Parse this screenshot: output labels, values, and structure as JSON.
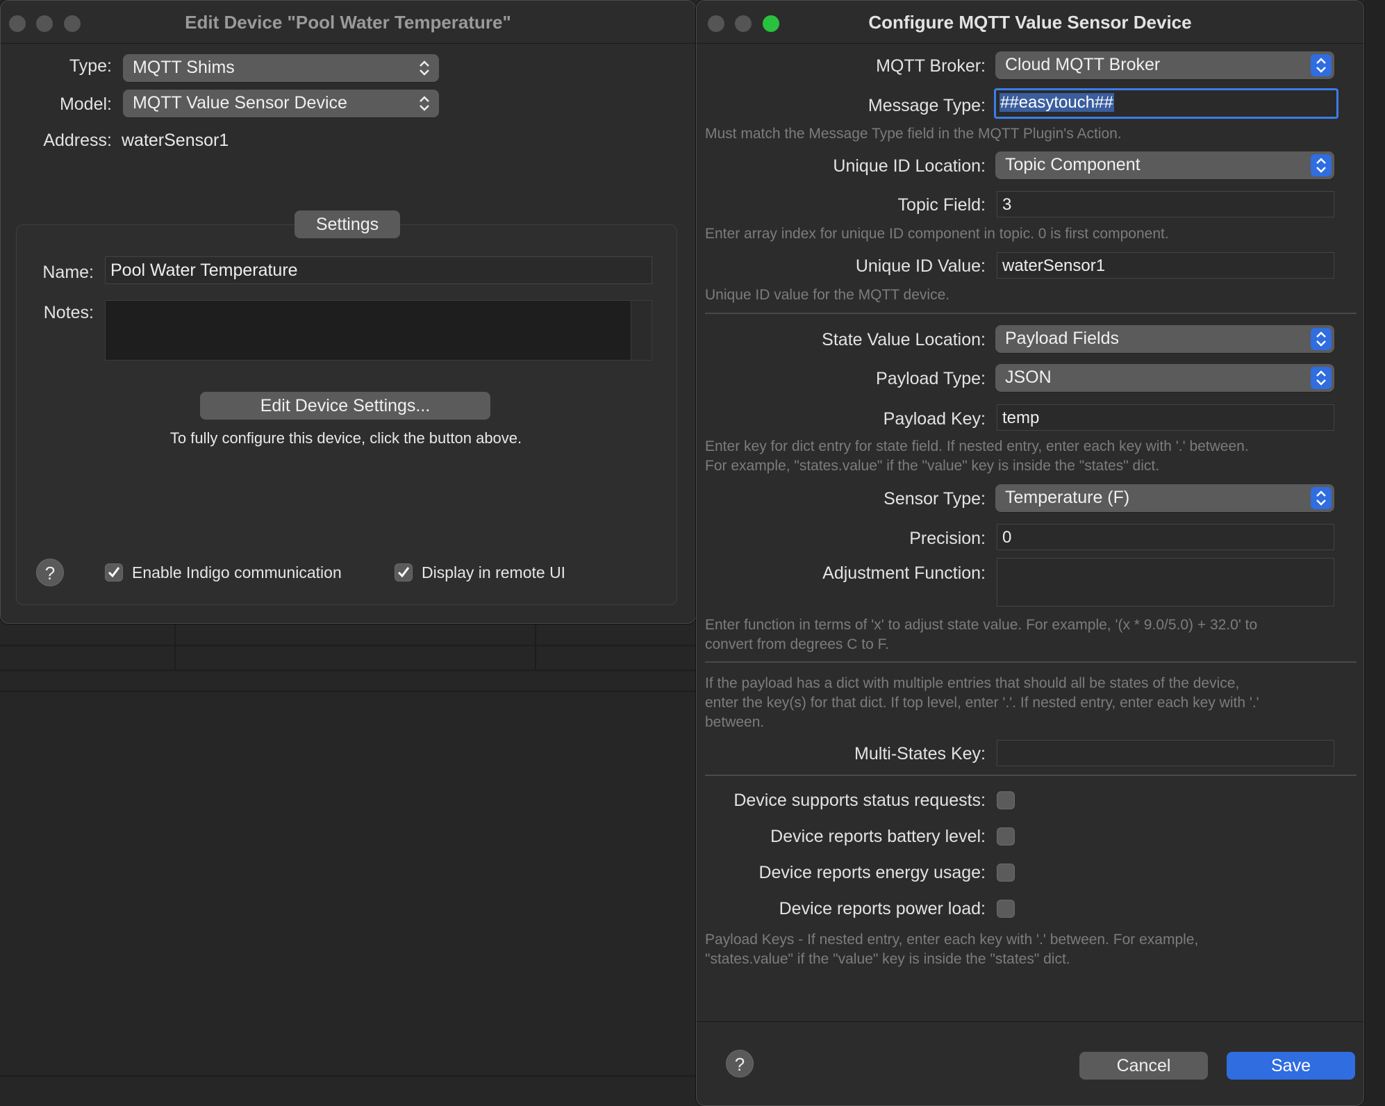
{
  "left_window": {
    "title": "Edit Device \"Pool Water Temperature\"",
    "type_label": "Type:",
    "type_value": "MQTT Shims",
    "model_label": "Model:",
    "model_value": "MQTT Value Sensor Device",
    "address_label": "Address:",
    "address_value": "waterSensor1",
    "settings_tab": "Settings",
    "name_label": "Name:",
    "name_value": "Pool Water Temperature",
    "notes_label": "Notes:",
    "edit_button": "Edit Device Settings...",
    "edit_hint": "To fully configure this device, click the button above.",
    "help": "?",
    "enable_comm_label": "Enable Indigo communication",
    "remote_ui_label": "Display in remote UI"
  },
  "right_window": {
    "title": "Configure MQTT Value Sensor Device",
    "broker_label": "MQTT Broker:",
    "broker_value": "Cloud MQTT Broker",
    "message_type_label": "Message Type:",
    "message_type_value": "##easytouch##",
    "message_type_hint": "Must match the Message Type field in the MQTT Plugin's Action.",
    "uid_location_label": "Unique ID Location:",
    "uid_location_value": "Topic Component",
    "topic_field_label": "Topic Field:",
    "topic_field_value": "3",
    "topic_field_hint": "Enter array index for unique ID component in topic.  0 is first component.",
    "uid_value_label": "Unique ID Value:",
    "uid_value_value": "waterSensor1",
    "uid_value_hint": "Unique ID value for the MQTT device.",
    "state_location_label": "State Value Location:",
    "state_location_value": "Payload Fields",
    "payload_type_label": "Payload Type:",
    "payload_type_value": "JSON",
    "payload_key_label": "Payload Key:",
    "payload_key_value": "temp",
    "payload_key_hint_1": "Enter key for dict entry for state field.  If nested entry, enter each key with '.' between.",
    "payload_key_hint_2": "For example, \"states.value\" if the \"value\" key is inside the \"states\" dict.",
    "sensor_type_label": "Sensor Type:",
    "sensor_type_value": "Temperature (F)",
    "precision_label": "Precision:",
    "precision_value": "0",
    "adjust_label": "Adjustment Function:",
    "adjust_hint_1": "Enter function in terms of 'x' to adjust state value. For example, '(x * 9.0/5.0) + 32.0' to",
    "adjust_hint_2": "convert from degrees C to F.",
    "multi_hint_1": "If the payload has a dict with multiple entries that should all be states of the device,",
    "multi_hint_2": "enter the key(s) for that dict.  If top level, enter '.'.  If nested entry, enter each key with '.'",
    "multi_hint_3": "between.",
    "multi_key_label": "Multi-States Key:",
    "status_req_label": "Device supports status requests:",
    "battery_label": "Device reports battery level:",
    "energy_label": "Device reports energy usage:",
    "power_label": "Device reports power load:",
    "payload_keys_hint_1": "Payload Keys - If nested entry, enter each key with '.' between.  For example,",
    "payload_keys_hint_2": "\"states.value\" if the \"value\" key is inside the \"states\" dict.",
    "help": "?",
    "cancel_button": "Cancel",
    "save_button": "Save"
  },
  "colors": {
    "accent": "#2f6de0",
    "window_bg": "#2c2c2c",
    "control_bg": "#5b5b5b",
    "hint_text": "#7c7c7c"
  }
}
